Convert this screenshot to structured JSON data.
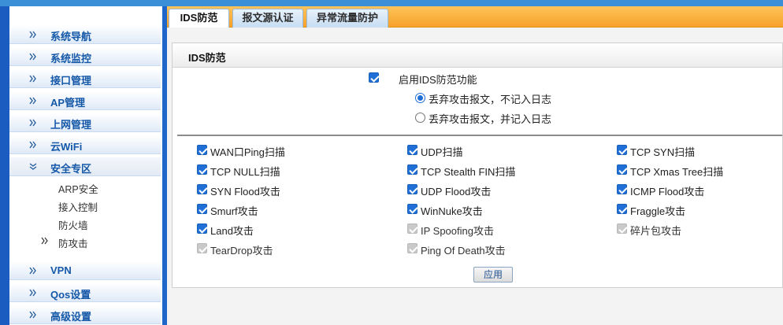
{
  "sidebar": {
    "items": [
      {
        "label": "系统导航"
      },
      {
        "label": "系统监控"
      },
      {
        "label": "接口管理"
      },
      {
        "label": "AP管理"
      },
      {
        "label": "上网管理"
      },
      {
        "label": "云WiFi"
      },
      {
        "label": "安全专区"
      },
      {
        "label": "VPN"
      },
      {
        "label": "Qos设置"
      },
      {
        "label": "高级设置"
      }
    ],
    "security_sub": [
      {
        "label": "ARP安全"
      },
      {
        "label": "接入控制"
      },
      {
        "label": "防火墙"
      },
      {
        "label": "防攻击"
      }
    ]
  },
  "tabs": [
    {
      "label": "IDS防范"
    },
    {
      "label": "报文源认证"
    },
    {
      "label": "异常流量防护"
    }
  ],
  "section": {
    "title": "IDS防范"
  },
  "enable": {
    "label": "启用IDS防范功能",
    "checked": true
  },
  "log_options": [
    {
      "label": "丢弃攻击报文，不记入日志",
      "selected": true
    },
    {
      "label": "丢弃攻击报文，并记入日志",
      "selected": false
    }
  ],
  "attacks": [
    {
      "label": "WAN口Ping扫描",
      "checked": true,
      "enabled": true
    },
    {
      "label": "UDP扫描",
      "checked": true,
      "enabled": true
    },
    {
      "label": "TCP SYN扫描",
      "checked": true,
      "enabled": true
    },
    {
      "label": "TCP NULL扫描",
      "checked": true,
      "enabled": true
    },
    {
      "label": "TCP Stealth FIN扫描",
      "checked": true,
      "enabled": true
    },
    {
      "label": "TCP Xmas Tree扫描",
      "checked": true,
      "enabled": true
    },
    {
      "label": "SYN Flood攻击",
      "checked": true,
      "enabled": true
    },
    {
      "label": "UDP Flood攻击",
      "checked": true,
      "enabled": true
    },
    {
      "label": "ICMP Flood攻击",
      "checked": true,
      "enabled": true
    },
    {
      "label": "Smurf攻击",
      "checked": true,
      "enabled": true
    },
    {
      "label": "WinNuke攻击",
      "checked": true,
      "enabled": true
    },
    {
      "label": "Fraggle攻击",
      "checked": true,
      "enabled": true
    },
    {
      "label": "Land攻击",
      "checked": true,
      "enabled": true
    },
    {
      "label": "IP Spoofing攻击",
      "checked": true,
      "enabled": false
    },
    {
      "label": "碎片包攻击",
      "checked": true,
      "enabled": false
    },
    {
      "label": "TearDrop攻击",
      "checked": true,
      "enabled": false
    },
    {
      "label": "Ping Of Death攻击",
      "checked": true,
      "enabled": false
    }
  ],
  "apply_label": "应用",
  "colors": {
    "accent": "#1f6fd6",
    "sidebar_text": "#1558a8",
    "tabbar": "#f7a12a"
  }
}
